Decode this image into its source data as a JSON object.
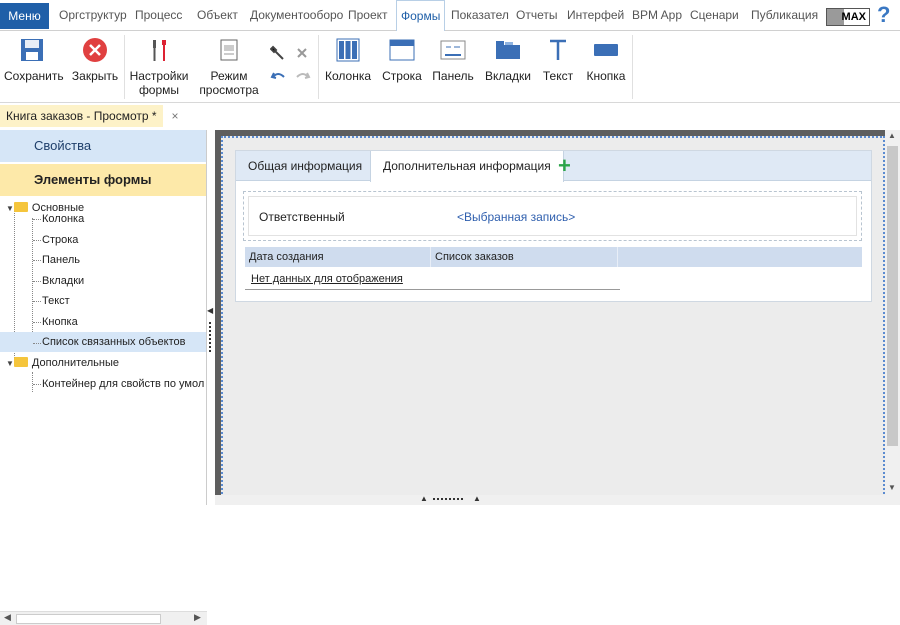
{
  "menubar": {
    "menu": "Меню",
    "items": [
      "Оргструктур",
      "Процесс",
      "Объект",
      "Документооборо",
      "Проект",
      "Формы",
      "Показател",
      "Отчеты",
      "Интерфей",
      "BPM App",
      "Сценари",
      "Публикация"
    ],
    "max": "MAX",
    "help": "?"
  },
  "ribbon": {
    "save": "Сохранить",
    "close": "Закрыть",
    "settings": [
      "Настройки",
      "формы"
    ],
    "view": [
      "Режим",
      "просмотра"
    ],
    "column": "Колонка",
    "row": "Строка",
    "panel": "Панель",
    "tabs": "Вкладки",
    "text": "Текст",
    "button": "Кнопка"
  },
  "doc_tab": {
    "title": "Книга заказов - Просмотр *",
    "close": "×"
  },
  "left": {
    "properties": "Свойства",
    "elements": "Элементы формы",
    "tree": {
      "basic": "Основные",
      "column": "Колонка",
      "row": "Строка",
      "panel": "Панель",
      "tabs": "Вкладки",
      "text": "Текст",
      "button": "Кнопка",
      "linked": "Список связанных объектов",
      "extra": "Дополнительные",
      "container": "Контейнер для свойств по умол"
    }
  },
  "form": {
    "tab1": "Общая информация",
    "tab2": "Дополнительная информация",
    "plus": "+",
    "field_label": "Ответственный",
    "field_value": "<Выбранная запись>",
    "col1": "Дата создания",
    "col2": "Список заказов",
    "nodata": "Нет данных для отображения"
  },
  "colors": {
    "accent": "#1f5fa8",
    "selected": "#d6e6f7",
    "highlight": "#fde9a9"
  }
}
